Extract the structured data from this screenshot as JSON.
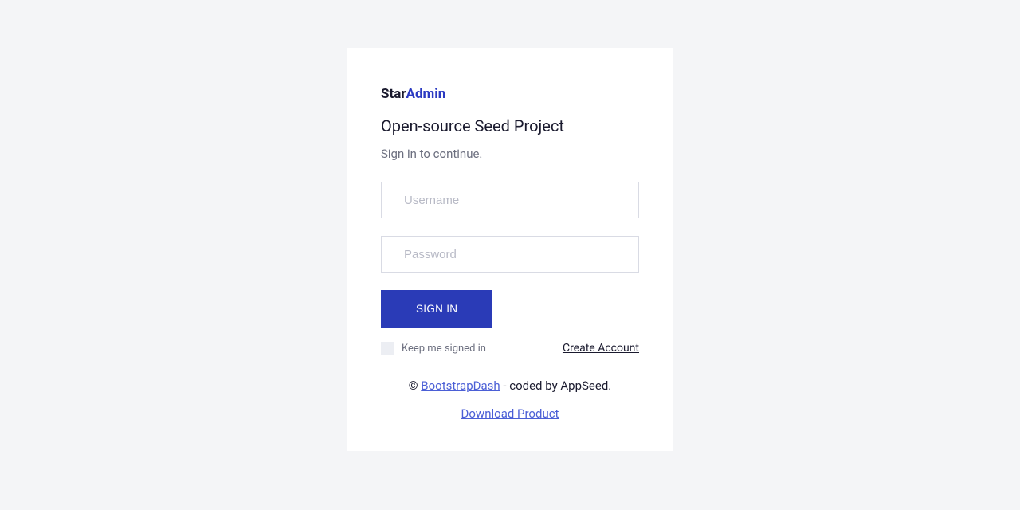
{
  "logo": {
    "part1": "Star",
    "part2": "Admin"
  },
  "heading": "Open-source Seed Project",
  "subheading": "Sign in to continue.",
  "form": {
    "username_placeholder": "Username",
    "password_placeholder": "Password",
    "signin_button": "SIGN IN",
    "keep_signed_label": "Keep me signed in",
    "create_account_label": "Create Account"
  },
  "footer": {
    "copyright": "© ",
    "vendor_link": "BootstrapDash",
    "coded_by": " - coded by AppSeed.",
    "download_label": "Download Product"
  }
}
